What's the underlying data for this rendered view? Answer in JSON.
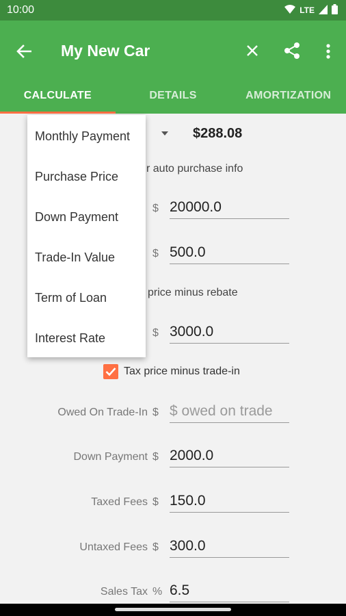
{
  "status": {
    "time": "10:00",
    "network": "LTE"
  },
  "appbar": {
    "title": "My New Car"
  },
  "tabs": [
    {
      "label": "CALCULATE",
      "active": true
    },
    {
      "label": "DETAILS",
      "active": false
    },
    {
      "label": "AMORTIZATION",
      "active": false
    }
  ],
  "calc": {
    "result": "$288.08"
  },
  "hints": {
    "auto_info": "r auto purchase info",
    "tax_rebate": "price minus rebate"
  },
  "dropdown": {
    "items": [
      "Monthly Payment",
      "Purchase Price",
      "Down Payment",
      "Trade-In Value",
      "Term of Loan",
      "Interest Rate"
    ]
  },
  "fields": {
    "purchase_price": {
      "prefix": "$",
      "value": "20000.0"
    },
    "rebate": {
      "prefix": "$",
      "value": "500.0"
    },
    "trade_in": {
      "prefix": "$",
      "value": "3000.0"
    },
    "owed_on_trade": {
      "label": "Owed On Trade-In",
      "prefix": "$",
      "value": "",
      "placeholder": "$ owed on trade"
    },
    "down_payment": {
      "label": "Down Payment",
      "prefix": "$",
      "value": "2000.0"
    },
    "taxed_fees": {
      "label": "Taxed Fees",
      "prefix": "$",
      "value": "150.0"
    },
    "untaxed_fees": {
      "label": "Untaxed Fees",
      "prefix": "$",
      "value": "300.0"
    },
    "sales_tax": {
      "label": "Sales Tax",
      "prefix": "%",
      "value": "6.5"
    }
  },
  "checkbox": {
    "label": "Tax price minus trade-in",
    "checked": true
  },
  "colors": {
    "primary": "#4caf50",
    "primary_dark": "#3d8b3d",
    "accent": "#ff7043"
  }
}
